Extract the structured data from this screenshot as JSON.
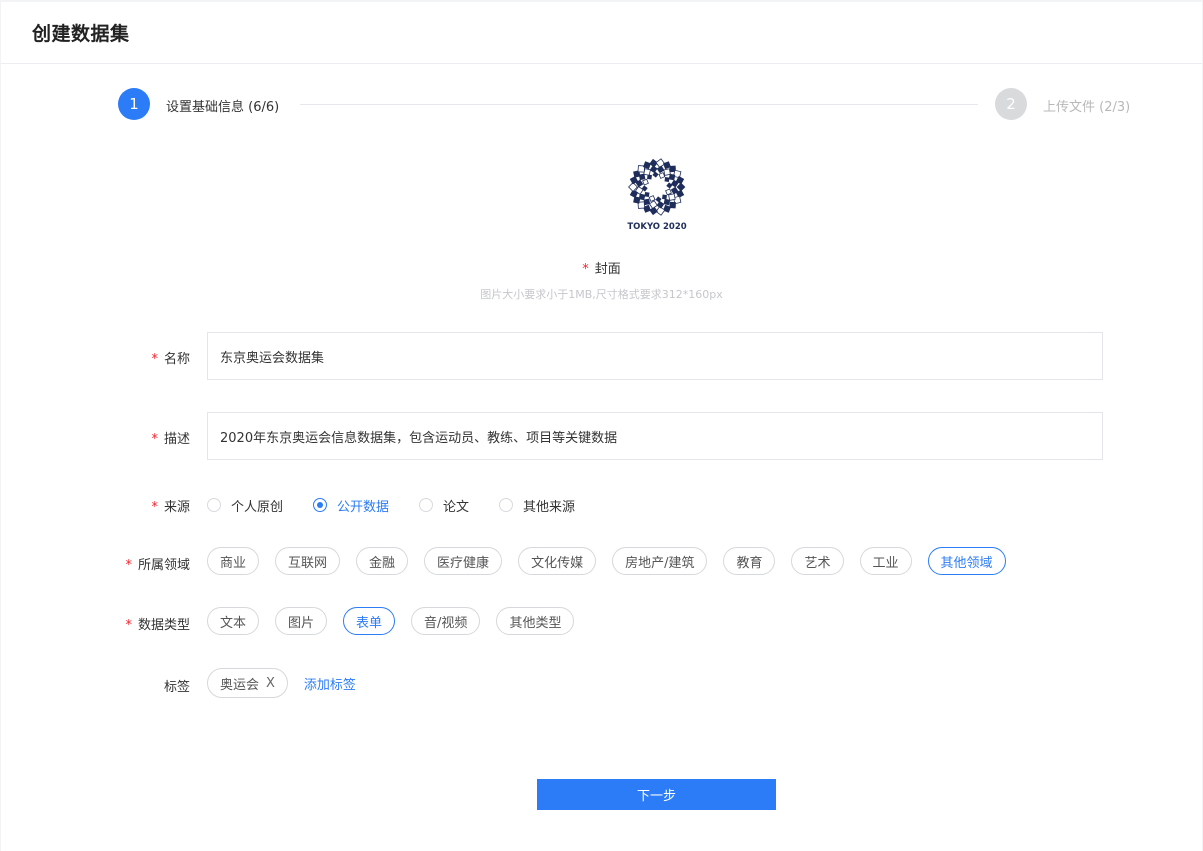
{
  "header": {
    "title": "创建数据集"
  },
  "steps": [
    {
      "number": "1",
      "label": "设置基础信息 (6/6)"
    },
    {
      "number": "2",
      "label": "上传文件 (2/3)"
    }
  ],
  "cover": {
    "label": "封面",
    "hint": "图片大小要求小于1MB,尺寸格式要求312*160px",
    "image_text": "TOKYO 2020"
  },
  "form": {
    "required_mark": "*",
    "name": {
      "label": "名称",
      "value": "东京奥运会数据集"
    },
    "description": {
      "label": "描述",
      "value": "2020年东京奥运会信息数据集，包含运动员、教练、项目等关键数据"
    },
    "source": {
      "label": "来源",
      "options": [
        "个人原创",
        "公开数据",
        "论文",
        "其他来源"
      ],
      "selected": "公开数据"
    },
    "domain": {
      "label": "所属领域",
      "options": [
        "商业",
        "互联网",
        "金融",
        "医疗健康",
        "文化传媒",
        "房地产/建筑",
        "教育",
        "艺术",
        "工业",
        "其他领域"
      ],
      "selected": "其他领域"
    },
    "data_type": {
      "label": "数据类型",
      "options": [
        "文本",
        "图片",
        "表单",
        "音/视频",
        "其他类型"
      ],
      "selected": "表单"
    },
    "tags": {
      "label": "标签",
      "items": [
        "奥运会"
      ],
      "remove_glyph": "X",
      "add_label": "添加标签"
    }
  },
  "next_button": {
    "label": "下一步"
  },
  "colors": {
    "primary": "#2b7cf6",
    "required": "#f5222d",
    "inactive_step": "#d9dadc",
    "logo": "#1f2d5a"
  }
}
